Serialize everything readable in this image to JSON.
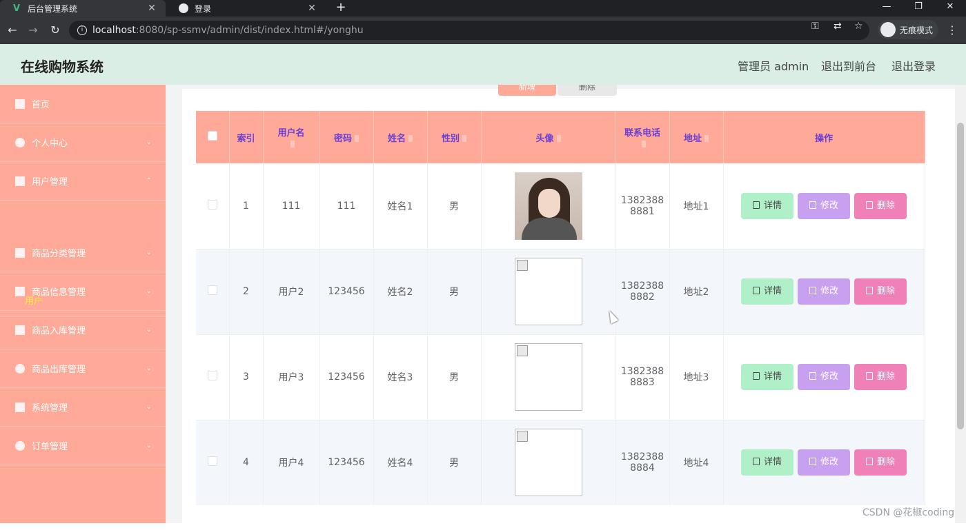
{
  "browser": {
    "tabs": [
      {
        "title": "后台管理系统",
        "active": true,
        "favicon": "vue-icon"
      },
      {
        "title": "登录",
        "active": false,
        "favicon": "globe-icon"
      }
    ],
    "new_tab": "+",
    "url_host": "localhost",
    "url_rest": ":8080/sp-ssmv/admin/dist/index.html#/yonghu",
    "incognito_label": "无痕模式",
    "window_controls": [
      "—",
      "❐",
      "✕"
    ]
  },
  "header": {
    "title": "在线购物系统",
    "admin_label": "管理员 admin",
    "front_link": "退出到前台",
    "logout_link": "退出登录"
  },
  "sidebar": {
    "items": [
      {
        "label": "首页",
        "icon": "home-icon",
        "expandable": false
      },
      {
        "label": "个人中心",
        "icon": "user-icon",
        "expandable": true
      },
      {
        "label": "用户管理",
        "icon": "send-icon",
        "expandable": true,
        "expanded": true
      },
      {
        "label": "商品分类管理",
        "icon": "grid-icon",
        "expandable": true
      },
      {
        "label": "商品信息管理",
        "icon": "clipboard-icon",
        "expandable": true
      },
      {
        "label": "商品入库管理",
        "icon": "video-icon",
        "expandable": true
      },
      {
        "label": "商品出库管理",
        "icon": "user-icon",
        "expandable": true
      },
      {
        "label": "系统管理",
        "icon": "flag-icon",
        "expandable": true
      },
      {
        "label": "订单管理",
        "icon": "compass-icon",
        "expandable": true
      }
    ],
    "submenu_active": "用户"
  },
  "toolbar": {
    "add_label": "新增",
    "delete_label": "删除"
  },
  "table": {
    "columns": [
      "",
      "索引",
      "用户名",
      "密码",
      "姓名",
      "性别",
      "头像",
      "联系电话",
      "地址",
      "操作"
    ],
    "rows": [
      {
        "index": "1",
        "username": "111",
        "password": "111",
        "name": "姓名1",
        "gender": "男",
        "avatar": "photo",
        "phone_a": "1382388",
        "phone_b": "8881",
        "address": "地址1"
      },
      {
        "index": "2",
        "username": "用户2",
        "password": "123456",
        "name": "姓名2",
        "gender": "男",
        "avatar": "broken",
        "phone_a": "1382388",
        "phone_b": "8882",
        "address": "地址2"
      },
      {
        "index": "3",
        "username": "用户3",
        "password": "123456",
        "name": "姓名3",
        "gender": "男",
        "avatar": "broken",
        "phone_a": "1382388",
        "phone_b": "8883",
        "address": "地址3"
      },
      {
        "index": "4",
        "username": "用户4",
        "password": "123456",
        "name": "姓名4",
        "gender": "男",
        "avatar": "broken",
        "phone_a": "1382388",
        "phone_b": "8884",
        "address": "地址4"
      }
    ],
    "actions": {
      "detail": "详情",
      "edit": "修改",
      "delete": "删除"
    }
  },
  "watermark": "CSDN @花椒coding"
}
